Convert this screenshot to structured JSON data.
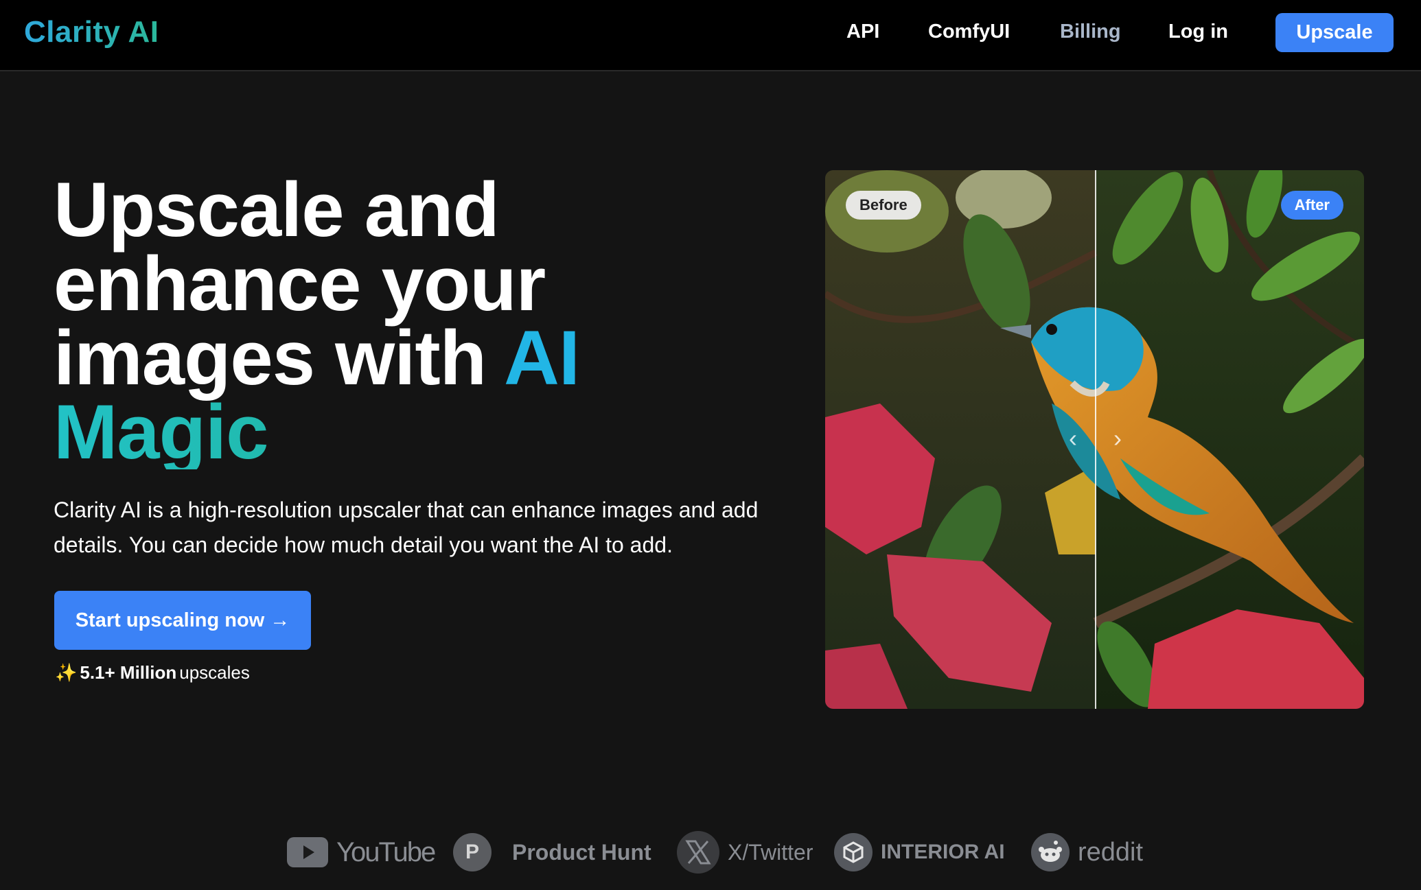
{
  "header": {
    "logo": "Clarity AI",
    "nav": [
      {
        "label": "API"
      },
      {
        "label": "ComfyUI"
      },
      {
        "label": "Billing"
      },
      {
        "label": "Log in"
      }
    ],
    "cta_label": "Upscale"
  },
  "hero": {
    "title_line1": "Upscale and",
    "title_line2": "enhance your",
    "title_line3": "images with",
    "title_accent_ai": "AI",
    "title_accent_magic": "Magic",
    "description": "Clarity AI is a high-resolution upscaler that can enhance images and add details. You can decide how much detail you want the AI to add.",
    "cta_label": "Start upscaling now →",
    "stats_count": "5.1+ Million",
    "stats_suffix": "upscales"
  },
  "compare": {
    "before_label": "Before",
    "after_label": "After",
    "left_arrow": "‹",
    "right_arrow": "›"
  },
  "logos": [
    {
      "name": "YouTube",
      "icon": "youtube-icon"
    },
    {
      "name": "Product Hunt",
      "icon": "product-hunt-icon",
      "letter": "P"
    },
    {
      "name": "X/Twitter",
      "icon": "x-twitter-icon"
    },
    {
      "name": "INTERIOR AI",
      "icon": "interior-ai-icon"
    },
    {
      "name": "reddit",
      "icon": "reddit-icon"
    }
  ],
  "colors": {
    "accent": "#3b82f6",
    "background": "#141414",
    "header_bg": "#000000",
    "logo_gradient": [
      "#2fa9dc",
      "#2bb89a"
    ],
    "ai_accent": "#22b6e6",
    "magic_gradient": [
      "#22c2c6",
      "#1fa97a"
    ]
  }
}
